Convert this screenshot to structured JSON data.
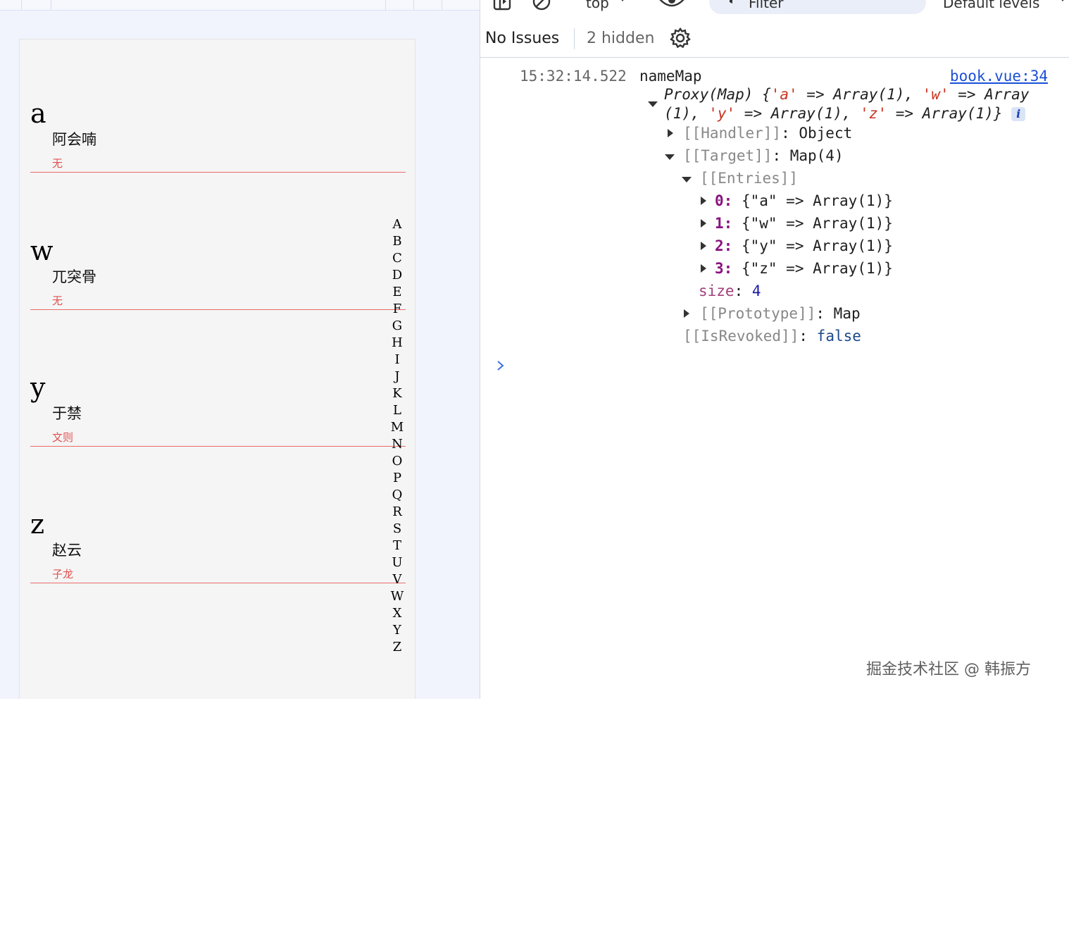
{
  "preview": {
    "groups": [
      {
        "letter": "a",
        "name": "阿会喃",
        "alias": "无"
      },
      {
        "letter": "w",
        "name": "兀突骨",
        "alias": "无"
      },
      {
        "letter": "y",
        "name": "于禁",
        "alias": "文则"
      },
      {
        "letter": "z",
        "name": "赵云",
        "alias": "子龙"
      }
    ],
    "index_letters": [
      "A",
      "B",
      "C",
      "D",
      "E",
      "F",
      "G",
      "H",
      "I",
      "J",
      "K",
      "L",
      "M",
      "N",
      "O",
      "P",
      "Q",
      "R",
      "S",
      "T",
      "U",
      "V",
      "W",
      "X",
      "Y",
      "Z"
    ]
  },
  "devtools": {
    "toolbar": {
      "context_label": "top",
      "filter_placeholder": "Filter",
      "levels_label": "Default levels"
    },
    "issues": {
      "no_issues_label": "No Issues",
      "hidden_label": "2 hidden"
    },
    "log": {
      "timestamp": "15:32:14.522",
      "label": "nameMap",
      "source": "book.vue:34",
      "summary_line1_prefix": "Proxy(Map) {",
      "summary_a": "'a'",
      "summary_arrow1": " => Array(1), ",
      "summary_w": "'w'",
      "summary_arrow2": " => Array",
      "summary_line2_prefix": "(1), ",
      "summary_y": "'y'",
      "summary_arrow3": " => Array(1), ",
      "summary_z": "'z'",
      "summary_arrow4": " => Array(1)}",
      "info_badge": "i",
      "handler_key": "[[Handler]]",
      "handler_val": "Object",
      "target_key": "[[Target]]",
      "target_val": "Map(4)",
      "entries_key": "[[Entries]]",
      "entries": [
        {
          "index": "0",
          "value": "{\"a\" => Array(1)}"
        },
        {
          "index": "1",
          "value": "{\"w\" => Array(1)}"
        },
        {
          "index": "2",
          "value": "{\"y\" => Array(1)}"
        },
        {
          "index": "3",
          "value": "{\"z\" => Array(1)}"
        }
      ],
      "size_key": "size",
      "size_val": "4",
      "prototype_key": "[[Prototype]]",
      "prototype_val": "Map",
      "revoked_key": "[[IsRevoked]]",
      "revoked_val": "false"
    }
  },
  "watermark": "掘金技术社区 @ 韩振方",
  "icons": [
    "panel-icon",
    "clear-console-icon",
    "dropdown-caret-icon",
    "eye-icon",
    "filter-icon",
    "gear-icon",
    "expand-arrow-icon",
    "console-prompt-icon"
  ],
  "colors": {
    "accent_red": "#e15050",
    "link_blue": "#1a4fd6",
    "key_purple": "#881280",
    "string_red": "#c8331f"
  }
}
